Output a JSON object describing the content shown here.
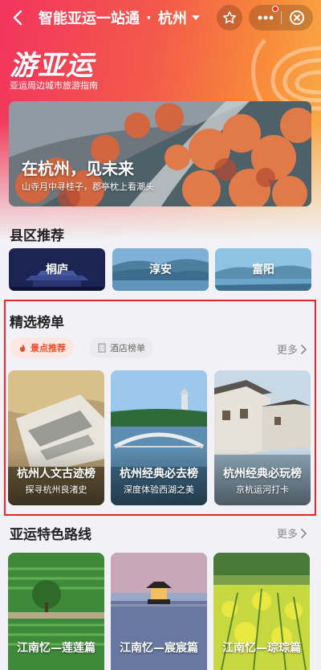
{
  "header": {
    "title": "智能亚运一站通",
    "separator": "·",
    "city": "杭州",
    "icons": [
      "back-arrow-icon",
      "star-icon",
      "more-dots-icon",
      "close-circle-icon"
    ]
  },
  "brand": {
    "name": "游亚运",
    "subtitle": "亚运周边城市旅游指南"
  },
  "banner": {
    "title": "在杭州，见未来",
    "subtitle": "山寺月中寻桂子，郡亭枕上看潮头"
  },
  "districts": {
    "title": "县区推荐",
    "items": [
      {
        "label": "桐庐"
      },
      {
        "label": "淳安"
      },
      {
        "label": "富阳"
      }
    ]
  },
  "rankings": {
    "title": "精选榜单",
    "more": "更多",
    "tabs": [
      {
        "label": "景点推荐",
        "active": true
      },
      {
        "label": "酒店榜单",
        "active": false
      }
    ],
    "cards": [
      {
        "title": "杭州人文古迹榜",
        "subtitle": "探寻杭州良渚史"
      },
      {
        "title": "杭州经典必去榜",
        "subtitle": "深度体验西湖之美"
      },
      {
        "title": "杭州经典必玩榜",
        "subtitle": "京杭运河打卡"
      }
    ]
  },
  "routes": {
    "title": "亚运特色路线",
    "more": "更多",
    "cards": [
      {
        "title": "江南忆—莲莲篇"
      },
      {
        "title": "江南忆—宸宸篇"
      },
      {
        "title": "江南忆—琮琮篇"
      }
    ]
  },
  "colors": {
    "accent": "#f04a2a",
    "highlight_border": "#e5262c",
    "header_gradient_start": "#f3345e",
    "header_gradient_end": "#f7b24a"
  }
}
